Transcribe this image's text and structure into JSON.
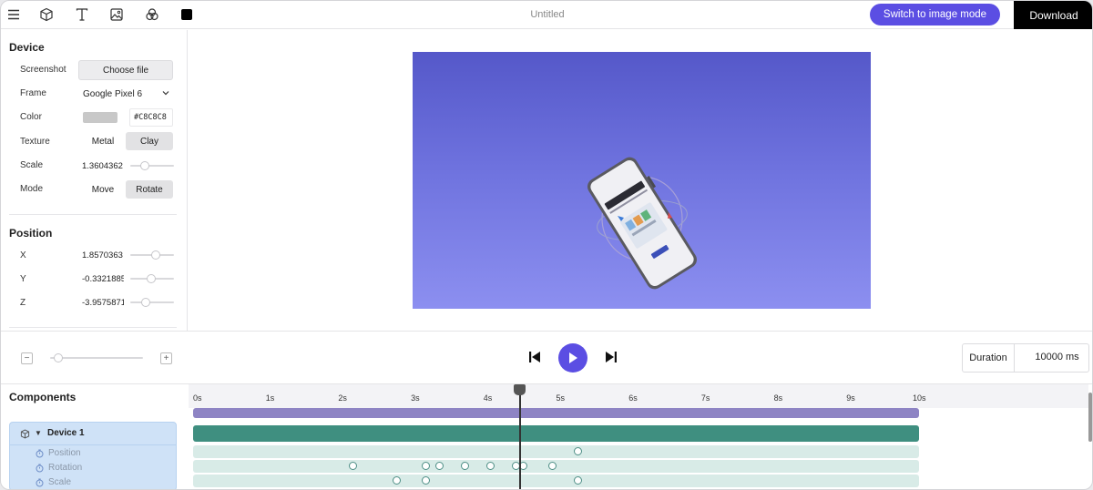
{
  "toolbar": {
    "icons": [
      "menu-icon",
      "cube-icon",
      "text-icon",
      "image-icon",
      "filter-icon",
      "color-swatch-icon"
    ],
    "title": "Untitled",
    "switch_label": "Switch to image mode",
    "download_label": "Download"
  },
  "device": {
    "section_title": "Device",
    "screenshot_label": "Screenshot",
    "choose_file": "Choose file",
    "frame_label": "Frame",
    "frame_value": "Google Pixel 6",
    "color_label": "Color",
    "color_hex": "#C8C8C8",
    "color_text": "#C8C8C8",
    "texture_label": "Texture",
    "texture_options": [
      "Metal",
      "Clay"
    ],
    "scale_label": "Scale",
    "scale_value": "1.3604362",
    "mode_label": "Mode",
    "mode_options": [
      "Move",
      "Rotate"
    ]
  },
  "position": {
    "section_title": "Position",
    "x_label": "X",
    "x_value": "1.8570363",
    "y_label": "Y",
    "y_value": "-0.3321885",
    "z_label": "Z",
    "z_value": "-3.9575871"
  },
  "controls": {
    "zoom_out": "−",
    "zoom_in": "+",
    "duration_label": "Duration",
    "duration_value": "10000",
    "duration_unit": "ms"
  },
  "timeline": {
    "components_title": "Components",
    "ticks": [
      "0s",
      "1s",
      "2s",
      "3s",
      "4s",
      "5s",
      "6s",
      "7s",
      "8s",
      "9s",
      "10s"
    ],
    "playhead_seconds": 4.5,
    "device_name": "Device 1",
    "tracks": [
      "Position",
      "Rotation",
      "Scale"
    ],
    "keyframes": {
      "Position": [
        5.3
      ],
      "Rotation": [
        2.2,
        3.2,
        3.4,
        3.75,
        4.1,
        4.45,
        4.55,
        4.95
      ],
      "Scale": [
        2.8,
        3.2,
        5.3
      ]
    },
    "colors": {
      "top_bar": "#8e84c4",
      "device_bar": "#3f8f80",
      "track_bg": "#d8ebe7"
    }
  }
}
